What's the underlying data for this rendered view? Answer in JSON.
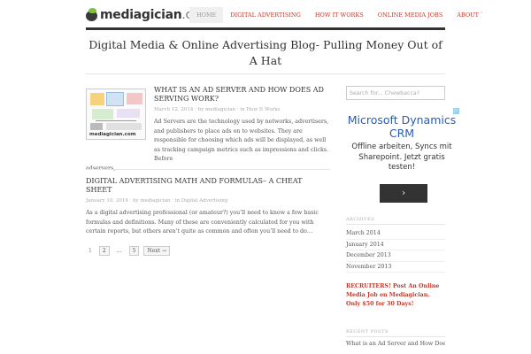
{
  "header": {
    "logo_main": "mediagician",
    "logo_domain": ".com",
    "nav": [
      {
        "label": "Home",
        "active": true
      },
      {
        "label": "Digital Advertising",
        "active": false
      },
      {
        "label": "How It Works",
        "active": false
      },
      {
        "label": "Online Media Jobs",
        "active": false
      },
      {
        "label": "About",
        "active": false
      }
    ],
    "nav_caret": "˅"
  },
  "tagline": "Digital Media & Online Advertising Blog- Pulling Money Out of A Hat",
  "posts": [
    {
      "title": "What is an Ad Server and How Does Ad Serving Work?",
      "date": "March 12, 2014",
      "author": "mediagician",
      "category": "How It Works",
      "excerpt": "Ad Servers are the technology used by networks, advertisers, and publishers to place ads on to websites. They are responsible for choosing which ads will be displayed, as well as tracking campaign metrics such as impressions and clicks. Before",
      "excerpt_tail": "adservers,…",
      "thumb_caption": "mediagician.com"
    },
    {
      "title": "Digital Advertising Math and Formulas– A Cheat Sheet",
      "date": "January 10, 2014",
      "author": "mediagician",
      "category": "Digital Advertising",
      "excerpt": "As a digital advertising professional (or amateur?) you’ll need to know a few basic formulas and definitions. Many of these are conveniently calculated for you with certain reports, but others aren’t quite as common and often you’ll need to do…"
    }
  ],
  "meta_by": "by",
  "meta_in": "in",
  "pagination": [
    "1",
    "2",
    "…",
    "5",
    "Next →"
  ],
  "sidebar": {
    "search_placeholder": "Search for... Chewbacca?",
    "ad": {
      "title": "Microsoft Dynamics CRM",
      "text": "Offline arbeiten, Syncs mit Sharepoint. Jetzt gratis testen!",
      "button": "›",
      "corner": "▷"
    },
    "archives_heading": "Archives",
    "archives": [
      "March 2014",
      "January 2014",
      "December 2013",
      "November 2013"
    ],
    "promo": "RECRUITERS! Post An Online Media Job on Mediagician. Only $50 for 30 Days!",
    "recent_heading": "Recent Posts",
    "recent": [
      "What is an Ad Server and How Does Ad Serving Work?"
    ]
  },
  "colors": {
    "accent": "#c0392b",
    "ad_blue": "#2a5db0",
    "dark": "#333333"
  }
}
